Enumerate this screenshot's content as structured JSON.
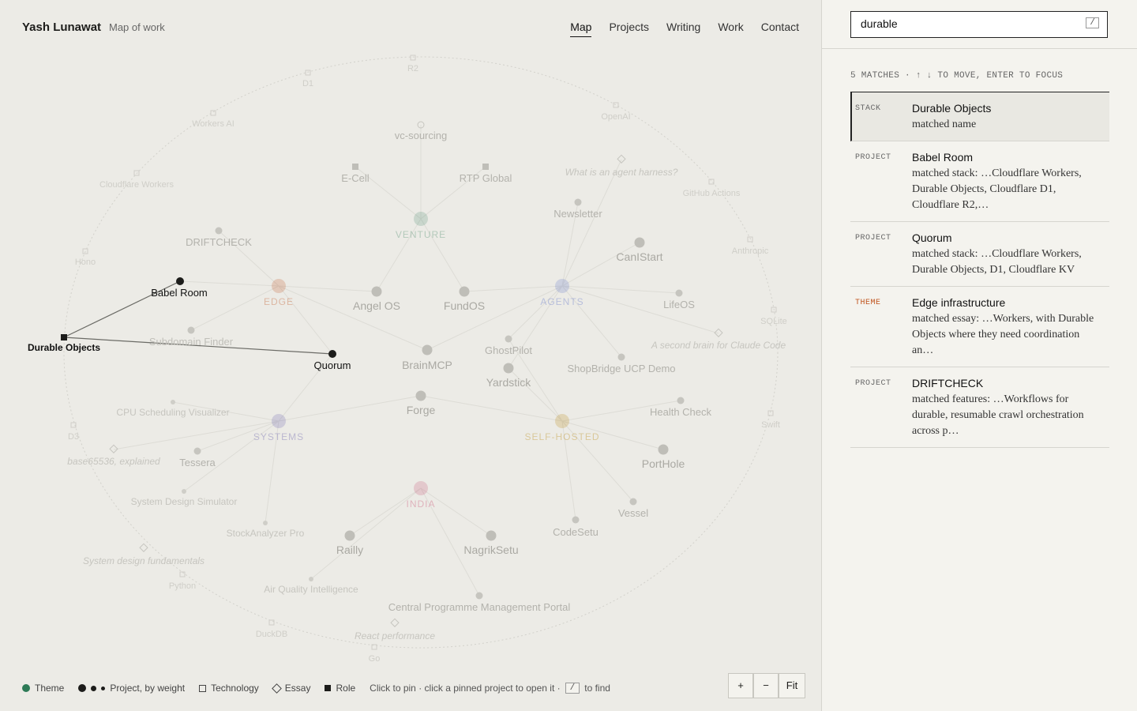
{
  "header": {
    "brand": "Yash Lunawat",
    "subtitle": "Map of work"
  },
  "nav": [
    {
      "label": "Map",
      "active": true
    },
    {
      "label": "Projects",
      "active": false
    },
    {
      "label": "Writing",
      "active": false
    },
    {
      "label": "Work",
      "active": false
    },
    {
      "label": "Contact",
      "active": false
    }
  ],
  "graph": {
    "themes": [
      {
        "label": "VENTURE",
        "color": "#2d7a56"
      },
      {
        "label": "EDGE",
        "color": "#c0541f"
      },
      {
        "label": "AGENTS",
        "color": "#3b57c4"
      },
      {
        "label": "SYSTEMS",
        "color": "#4a3fa0"
      },
      {
        "label": "SELF-HOSTED",
        "color": "#b8860b"
      },
      {
        "label": "INDIA",
        "color": "#c43b62"
      }
    ],
    "projects": [
      "Angel OS",
      "FundOS",
      "CanIStart",
      "LifeOS",
      "Newsletter",
      "DRIFTCHECK",
      "Subdomain Finder",
      "BrainMCP",
      "GhostPilot",
      "Yardstick",
      "ShopBridge UCP Demo",
      "Forge",
      "Health Check",
      "PortHole",
      "Vessel",
      "CodeSetu",
      "Tessera",
      "CPU Scheduling Visualizer",
      "System Design Simulator",
      "StockAnalyzer Pro",
      "Railly",
      "NagrikSetu",
      "Air Quality Intelligence",
      "Central Programme Management Portal"
    ],
    "highlighted_projects": [
      "Babel Room",
      "Quorum"
    ],
    "roles": [
      "E-Cell",
      "RTP Global"
    ],
    "highlighted_role": "Durable Objects",
    "technologies": [
      "R2",
      "D1",
      "Workers AI",
      "OpenAI",
      "Cloudflare Workers",
      "GitHub Actions",
      "Anthropic",
      "Hono",
      "SQLite",
      "Swift",
      "D3",
      "Python",
      "DuckDB",
      "Go"
    ],
    "essays": [
      "What is an agent harness?",
      "A second brain for Claude Code",
      "base65536, explained",
      "System design fundamentals",
      "React performance"
    ],
    "other": [
      "vc-sourcing"
    ]
  },
  "legend": {
    "theme": "Theme",
    "project": "Project, by weight",
    "technology": "Technology",
    "essay": "Essay",
    "role": "Role",
    "hint_before": "Click to pin · click a pinned project to open it ·",
    "hint_key": "/",
    "hint_after": "to find"
  },
  "zoom": {
    "in": "+",
    "out": "−",
    "fit": "Fit"
  },
  "search": {
    "value": "durable",
    "key": "/"
  },
  "results_count": "5 MATCHES · ↑ ↓ TO MOVE, ENTER TO FOCUS",
  "results": [
    {
      "type": "STACK",
      "name": "Durable Objects",
      "desc": "matched name"
    },
    {
      "type": "PROJECT",
      "name": "Babel Room",
      "desc": "matched stack: …Cloudflare Workers, Durable Objects, Cloudflare D1, Cloudflare R2,…"
    },
    {
      "type": "PROJECT",
      "name": "Quorum",
      "desc": "matched stack: …Cloudflare Workers, Durable Objects, D1, Cloudflare KV"
    },
    {
      "type": "THEME",
      "name": "Edge infrastructure",
      "desc": "matched essay: …Workers, with Durable Objects where they need coordination an…"
    },
    {
      "type": "PROJECT",
      "name": "DRIFTCHECK",
      "desc": "matched features: …Workflows for durable, resumable crawl orchestration across p…"
    }
  ]
}
